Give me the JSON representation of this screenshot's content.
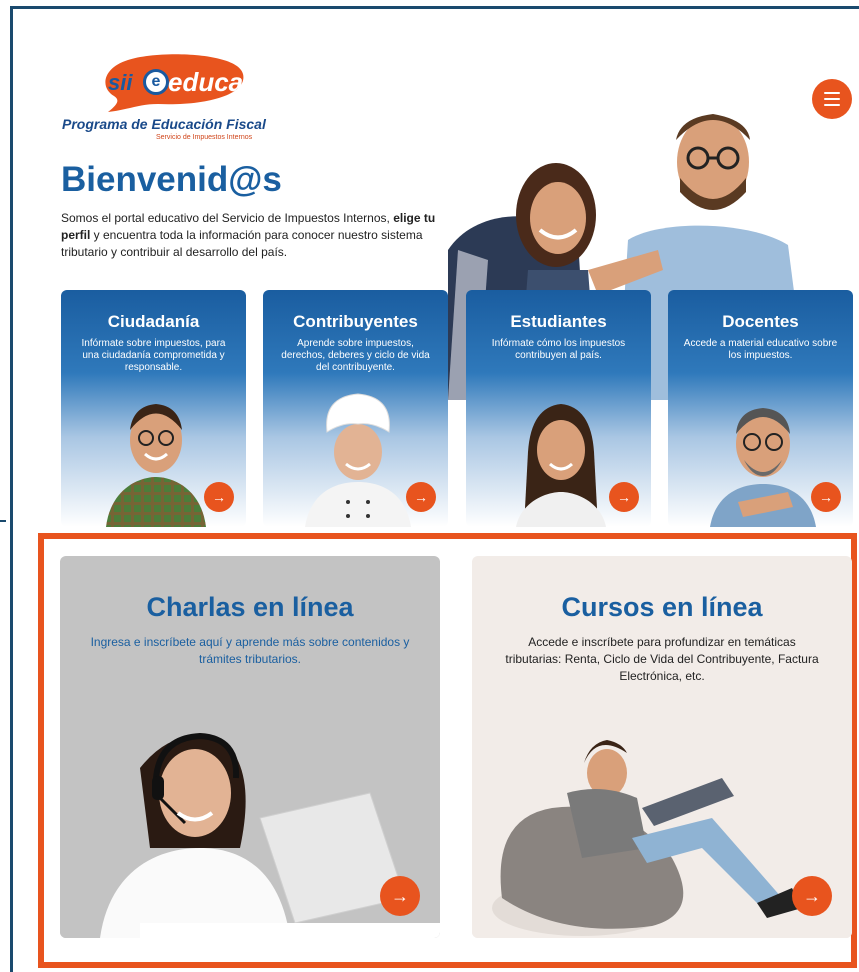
{
  "logo": {
    "sii": "sii",
    "at": "e",
    "educa": "educa",
    "program": "Programa de Educación Fiscal",
    "service": "Servicio de Impuestos Internos"
  },
  "hero": {
    "title": "Bienvenid@s",
    "text_1": "Somos el portal educativo del Servicio de Impuestos Internos, ",
    "text_bold_1": "elige tu perfil",
    "text_2": " y encuentra toda la información para conocer nuestro sistema tributario y contribuir al desarrollo del país."
  },
  "profiles": [
    {
      "title": "Ciudadanía",
      "desc": "Infórmate sobre impuestos, para una ciudadanía comprometida y responsable.",
      "arrow": "→"
    },
    {
      "title": "Contribuyentes",
      "desc": "Aprende sobre impuestos, derechos, deberes y ciclo de vida del contribuyente.",
      "arrow": "→"
    },
    {
      "title": "Estudiantes",
      "desc": "Infórmate cómo los impuestos contribuyen al país.",
      "arrow": "→"
    },
    {
      "title": "Docentes",
      "desc": "Accede a material educativo sobre los impuestos.",
      "arrow": "→"
    }
  ],
  "charlas": {
    "title": "Charlas en línea",
    "desc": "Ingresa e inscríbete aquí y aprende más sobre contenidos y trámites tributarios.",
    "arrow": "→"
  },
  "cursos": {
    "title": "Cursos en línea",
    "desc": "Accede e inscríbete para profundizar en temáticas tributarias: Renta, Ciclo de Vida del Contribuyente, Factura Electrónica, etc.",
    "arrow": "→"
  },
  "colors": {
    "brand_blue": "#1a5fa0",
    "accent_orange": "#e8541e",
    "frame_blue": "#1a4a6e"
  },
  "icons": {
    "menu": "hamburger-menu-icon",
    "arrow": "arrow-right-icon"
  }
}
